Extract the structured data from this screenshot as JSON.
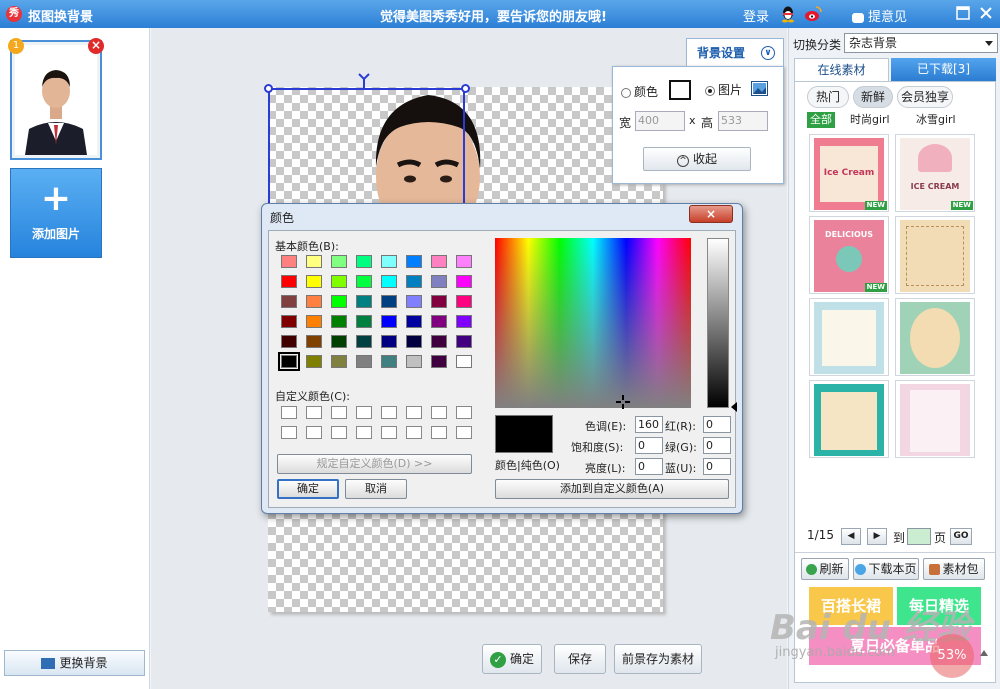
{
  "app": {
    "logo_text": "秀",
    "title": "抠图换背景",
    "slogan": "觉得美图秀秀好用，要告诉您的朋友哦!",
    "login": "登录",
    "feedback": "提意见",
    "icons": [
      "qq-icon",
      "weibo-icon",
      "maximize-icon",
      "close-icon"
    ]
  },
  "left": {
    "thumb_index": "1",
    "thumb_delete": "×",
    "add_plus": "+",
    "add_label": "添加图片",
    "change_bg": "更换背景"
  },
  "bg_settings": {
    "title": "背景设置",
    "chevron": "∨",
    "color_label": "颜色",
    "image_label": "图片",
    "width_label": "宽",
    "width_value": "400",
    "times": "x",
    "height_label": "高",
    "height_value": "533",
    "collapse_label": "收起",
    "collapse_icon": "^"
  },
  "color_dialog": {
    "title": "颜色",
    "close": "×",
    "basic_colors_label": "基本颜色(B):",
    "custom_colors_label": "自定义颜色(C):",
    "define_custom": "规定自定义颜色(D) >>",
    "ok": "确定",
    "cancel": "取消",
    "solid_label": "颜色|纯色(O)",
    "hue_label": "色调(E):",
    "hue_value": "160",
    "sat_label": "饱和度(S):",
    "sat_value": "0",
    "lum_label": "亮度(L):",
    "lum_value": "0",
    "red_label": "红(R):",
    "red_value": "0",
    "green_label": "绿(G):",
    "green_value": "0",
    "blue_label": "蓝(U):",
    "blue_value": "0",
    "add_custom": "添加到自定义颜色(A)",
    "basic_colors": [
      "#ff8080",
      "#ffff80",
      "#80ff80",
      "#00ff80",
      "#80ffff",
      "#0080ff",
      "#ff80c0",
      "#ff80ff",
      "#ff0000",
      "#ffff00",
      "#80ff00",
      "#00ff40",
      "#00ffff",
      "#0080c0",
      "#8080c0",
      "#ff00ff",
      "#804040",
      "#ff8040",
      "#00ff00",
      "#008080",
      "#004080",
      "#8080ff",
      "#800040",
      "#ff0080",
      "#800000",
      "#ff8000",
      "#008000",
      "#008040",
      "#0000ff",
      "#0000a0",
      "#800080",
      "#8000ff",
      "#400000",
      "#804000",
      "#004000",
      "#004040",
      "#000080",
      "#000040",
      "#400040",
      "#400080",
      "#000000",
      "#808000",
      "#808040",
      "#808080",
      "#408080",
      "#c0c0c0",
      "#400040",
      "#ffffff"
    ]
  },
  "canvas_buttons": {
    "ok": "确定",
    "ok_icon": "✓",
    "save": "保存",
    "save_foreground": "前景存为素材"
  },
  "right": {
    "category_label": "切换分类",
    "category_value": "杂志背景",
    "tab_online": "在线素材",
    "tab_downloaded": "已下载[3]",
    "pills": [
      "热门",
      "新鲜",
      "会员独享"
    ],
    "subfilters": [
      "全部",
      "时尚girl",
      "冰雪girl"
    ],
    "new_badge": "NEW",
    "tile_texts": [
      "Ice Cream",
      "ICE CREAM",
      "DELICIOUS",
      "",
      "",
      "",
      "",
      ""
    ],
    "page_text": "1/15",
    "prev": "◀",
    "next": "▶",
    "to_label": "到",
    "page_unit": "页",
    "go": "GO",
    "refresh": "刷新",
    "download_page": "下载本页",
    "material_pack": "素材包",
    "promo1": "百搭长裙",
    "promo2": "每日精选",
    "promo3": "夏日必备单品"
  },
  "overlay": {
    "watermark": "Bai du 经验",
    "watermark_url": "jingyan.baidu.com",
    "percent": "53%"
  }
}
